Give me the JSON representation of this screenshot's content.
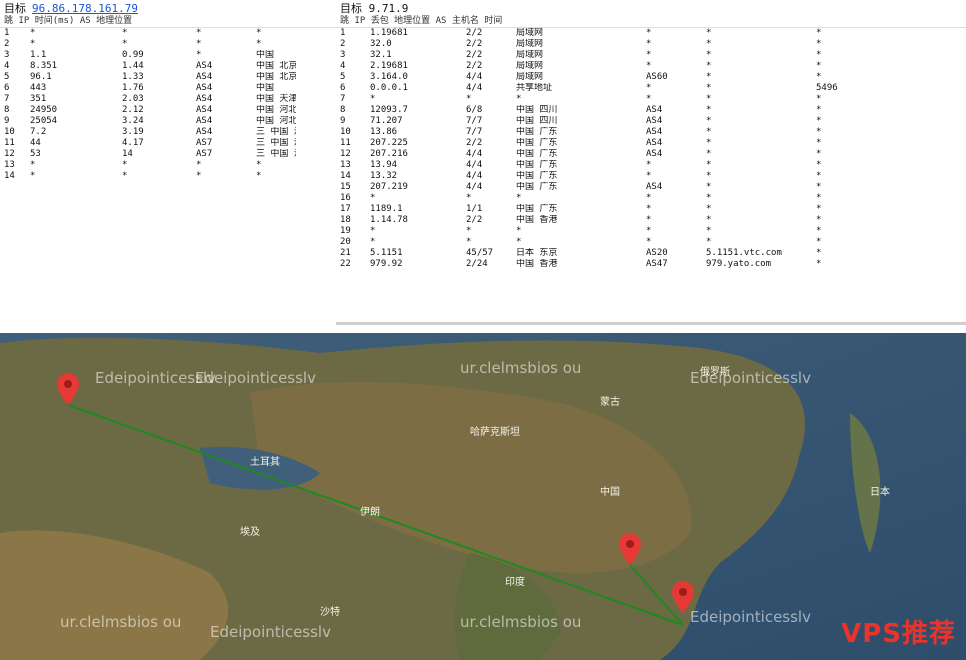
{
  "left_panel": {
    "title": "目标",
    "target_ip": "96.86.178.161.79",
    "columns": [
      "跳",
      "IP",
      "时间(ms)",
      "AS",
      "地理位置"
    ],
    "rows": [
      [
        "1",
        "*",
        "*",
        "*",
        "*"
      ],
      [
        "2",
        "*",
        "*",
        "*",
        "*"
      ],
      [
        "3",
        "1.1",
        "0.99",
        "*",
        "中国"
      ],
      [
        "4",
        "8.351",
        "1.44",
        "AS4",
        "中国 北京"
      ],
      [
        "5",
        "96.1",
        "1.33",
        "AS4",
        "中国 北京"
      ],
      [
        "6",
        "443",
        "1.76",
        "AS4",
        "中国"
      ],
      [
        "7",
        "351",
        "2.03",
        "AS4",
        "中国 天津"
      ],
      [
        "8",
        "24950",
        "2.12",
        "AS4",
        "中国 河北"
      ],
      [
        "9",
        "25054",
        "3.24",
        "AS4",
        "中国 河北"
      ],
      [
        "10",
        "7.2",
        "3.19",
        "AS4",
        "三 中国 河北"
      ],
      [
        "11",
        "44",
        "4.17",
        "AS7",
        "三 中国 河北"
      ],
      [
        "12",
        "53",
        "14",
        "AS7",
        "三 中国 河北"
      ],
      [
        "13",
        "*",
        "*",
        "*",
        "*"
      ],
      [
        "14",
        "*",
        "*",
        "*",
        "*"
      ]
    ]
  },
  "right_panel": {
    "title": "目标",
    "target_ip": "9.71.9",
    "columns": [
      "跳",
      "IP",
      "丢包",
      "地理位置",
      "AS",
      "主机名",
      "时间"
    ],
    "rows": [
      [
        "1",
        "1.19681",
        "2/2",
        "局域网",
        "*",
        "*",
        "*"
      ],
      [
        "2",
        "32.0",
        "2/2",
        "局域网",
        "*",
        "*",
        "*"
      ],
      [
        "3",
        "32.1",
        "2/2",
        "局域网",
        "*",
        "*",
        "*"
      ],
      [
        "4",
        "2.19681",
        "2/2",
        "局域网",
        "*",
        "*",
        "*"
      ],
      [
        "5",
        "3.164.0",
        "4/4",
        "局域网",
        "AS60",
        "*",
        "*"
      ],
      [
        "6",
        "0.0.0.1",
        "4/4",
        "共享地址",
        "*",
        "*",
        "5496"
      ],
      [
        "7",
        "*",
        "*",
        "*",
        "*",
        "*",
        "*"
      ],
      [
        "8",
        "12093.7",
        "6/8",
        "中国 四川",
        "AS4",
        "*",
        "*"
      ],
      [
        "9",
        "71.207",
        "7/7",
        "中国 四川",
        "AS4",
        "*",
        "*"
      ],
      [
        "10",
        "13.86",
        "7/7",
        "中国 广东",
        "AS4",
        "*",
        "*"
      ],
      [
        "11",
        "207.225",
        "2/2",
        "中国 广东",
        "AS4",
        "*",
        "*"
      ],
      [
        "12",
        "207.216",
        "4/4",
        "中国 广东",
        "AS4",
        "*",
        "*"
      ],
      [
        "13",
        "13.94",
        "4/4",
        "中国 广东",
        "*",
        "*",
        "*"
      ],
      [
        "14",
        "13.32",
        "4/4",
        "中国 广东",
        "*",
        "*",
        "*"
      ],
      [
        "15",
        "207.219",
        "4/4",
        "中国 广东",
        "AS4",
        "*",
        "*"
      ],
      [
        "16",
        "*",
        "*",
        "*",
        "*",
        "*",
        "*"
      ],
      [
        "17",
        "1189.1",
        "1/1",
        "中国 广东",
        "*",
        "*",
        "*"
      ],
      [
        "18",
        "1.14.78",
        "2/2",
        "中国 香港",
        "*",
        "*",
        "*"
      ],
      [
        "19",
        "*",
        "*",
        "*",
        "*",
        "*",
        "*"
      ],
      [
        "20",
        "*",
        "*",
        "*",
        "*",
        "*",
        "*"
      ],
      [
        "21",
        "5.1151",
        "45/57",
        "日本 东京",
        "AS20",
        "5.1151.vtc.com",
        "*"
      ],
      [
        "22",
        "979.92",
        "2/24",
        "中国 香港",
        "AS47",
        "979.yato.com",
        "*"
      ]
    ]
  },
  "map": {
    "watermark_text": "Edeipointicesslv",
    "watermark_text_2": "ur.clelmsbios ou",
    "brand": "VPS推荐",
    "place_labels": [
      "日本",
      "中国",
      "印度",
      "蒙古",
      "哈萨克斯坦",
      "伊朗",
      "沙特",
      "埃及",
      "土耳其",
      "俄罗斯"
    ],
    "route_color": "#1e8a1e",
    "pin_color": "#e53935"
  }
}
